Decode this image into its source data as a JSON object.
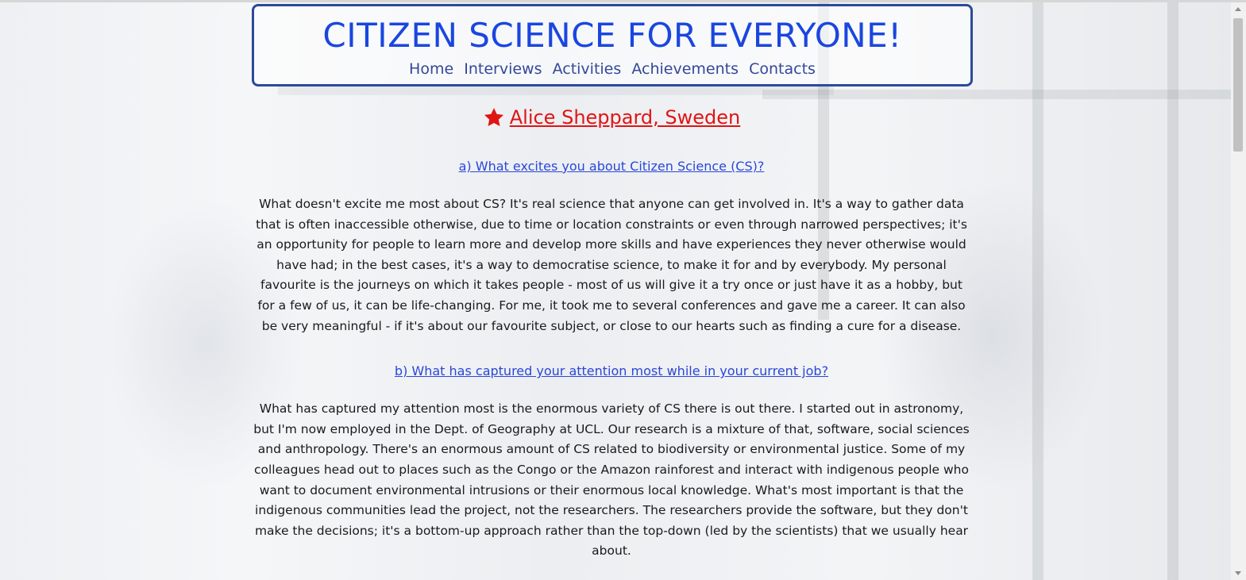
{
  "header": {
    "title": "CITIZEN SCIENCE FOR EVERYONE!",
    "nav": [
      "Home",
      "Interviews",
      "Activities",
      "Achievements",
      "Contacts"
    ]
  },
  "interview": {
    "person": "Alice Sheppard, Sweden",
    "person_icon": "star-icon",
    "questions": [
      {
        "question": "a) What excites you about Citizen Science (CS)?",
        "answer": "What doesn't excite me most about CS? It's real science that anyone can get involved in. It's a way to gather data that is often inaccessible otherwise, due to time or location constraints or even through narrowed perspectives; it's an opportunity for people to learn more and develop more skills and have experiences they never otherwise would have had; in the best cases, it's a way to democratise science, to make it for and by everybody. My personal favourite is the journeys on which it takes people - most of us will give it a try once or just have it as a hobby, but for a few of us, it can be life-changing. For me, it took me to several conferences and gave me a career. It can also be very meaningful - if it's about our favourite subject, or close to our hearts such as finding a cure for a disease."
      },
      {
        "question": "b) What has captured your attention most while in your current job?",
        "answer": "What has captured my attention most is the enormous variety of CS there is out there. I started out in astronomy, but I'm now employed in the Dept. of Geography at UCL. Our research is a mixture of that, software, social sciences and anthropology. There's an enormous amount of CS related to biodiversity or environmental justice. Some of my colleagues head out to places such as the Congo or the Amazon rainforest and interact with indigenous people who want to document environmental intrusions or their enormous local knowledge. What's most important is that the indigenous communities lead the project, not the researchers. The researchers provide the software, but they don't make the decisions; it's a bottom-up approach rather than the top-down (led by the scientists) that we usually hear about."
      }
    ]
  },
  "colors": {
    "title": "#1a46e0",
    "nav": "#33489a",
    "border": "#2c4a9a",
    "person": "#e11414",
    "question": "#2a47d8"
  }
}
